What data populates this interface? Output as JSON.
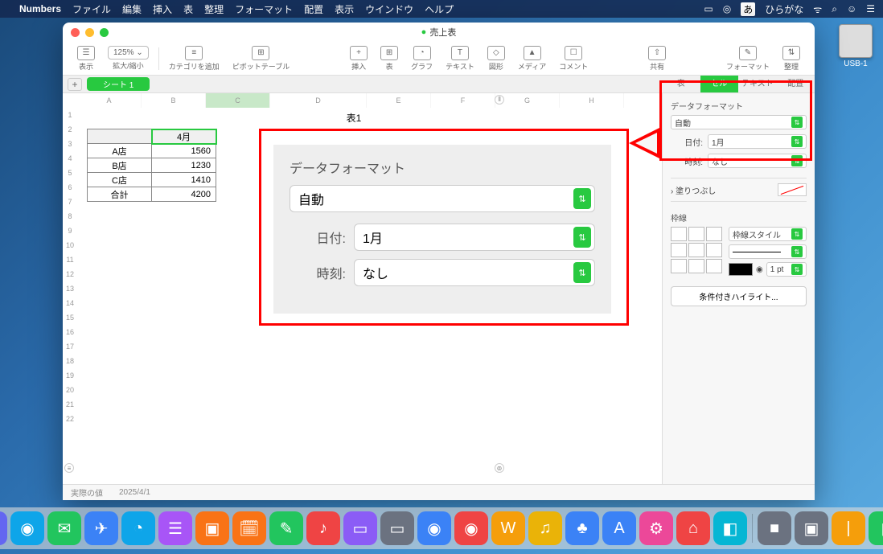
{
  "menubar": {
    "app": "Numbers",
    "items": [
      "ファイル",
      "編集",
      "挿入",
      "表",
      "整理",
      "フォーマット",
      "配置",
      "表示",
      "ウインドウ",
      "ヘルプ"
    ],
    "ime": "あ",
    "ime_label": "ひらがな"
  },
  "window": {
    "title": "売上表",
    "zoom": "125% ⌄"
  },
  "toolbar": {
    "view": "表示",
    "zoom": "拡大/縮小",
    "category": "カテゴリを追加",
    "pivot": "ピボットテーブル",
    "insert": "挿入",
    "table": "表",
    "chart": "グラフ",
    "text": "テキスト",
    "shape": "図形",
    "media": "メディア",
    "comment": "コメント",
    "share": "共有",
    "format": "フォーマット",
    "organize": "整理"
  },
  "sheet_tab": "シート 1",
  "inspector_tabs": {
    "table": "表",
    "cell": "セル",
    "text": "テキスト",
    "layout": "配置"
  },
  "columns": [
    "A",
    "B",
    "C",
    "D",
    "E",
    "F",
    "G",
    "H"
  ],
  "rows": [
    "1",
    "2",
    "3",
    "4",
    "5",
    "6",
    "7",
    "8",
    "9",
    "10",
    "11",
    "12",
    "13",
    "14",
    "15",
    "16",
    "17",
    "18",
    "19",
    "20",
    "21",
    "22"
  ],
  "table": {
    "title": "表1",
    "header_month": "4月",
    "rows": [
      {
        "store": "A店",
        "value": "1560"
      },
      {
        "store": "B店",
        "value": "1230"
      },
      {
        "store": "C店",
        "value": "1410"
      },
      {
        "store": "合計",
        "value": "4200"
      }
    ]
  },
  "inspector": {
    "data_format_label": "データフォーマット",
    "data_format_value": "自動",
    "date_label": "日付:",
    "date_value": "1月",
    "time_label": "時刻:",
    "time_value": "なし",
    "fill_label": "塗りつぶし",
    "border_label": "枠線",
    "border_style": "枠線スタイル",
    "border_width": "1 pt",
    "highlight_btn": "条件付きハイライト..."
  },
  "callout": {
    "title": "データフォーマット",
    "format_value": "自動",
    "date_label": "日付:",
    "date_value": "1月",
    "time_label": "時刻:",
    "time_value": "なし"
  },
  "statusbar": {
    "label": "実際の値",
    "value": "2025/4/1"
  },
  "desktop": {
    "drive": "USB-1"
  },
  "dock_colors": [
    "#3b82f6",
    "#6366f1",
    "#0ea5e9",
    "#22c55e",
    "#3b82f6",
    "#0ea5e9",
    "#a855f7",
    "#f97316",
    "#f97316",
    "#22c55e",
    "#ef4444",
    "#8b5cf6",
    "#6b7280",
    "#3b82f6",
    "#ef4444",
    "#f59e0b",
    "#eab308",
    "#3b82f6",
    "#3b82f6",
    "#ec4899",
    "#ef4444",
    "#06b6d4",
    "#6b7280",
    "#6b7280",
    "#f59e0b",
    "#22c55e"
  ]
}
